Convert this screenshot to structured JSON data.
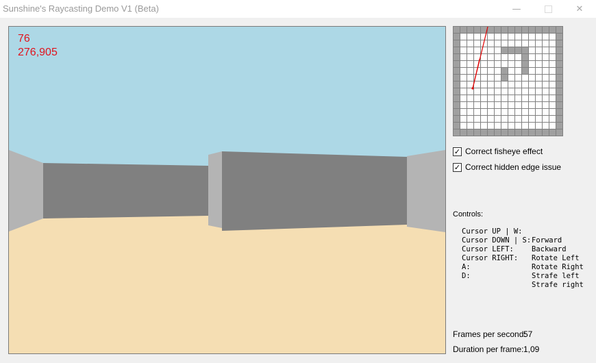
{
  "window": {
    "title": "Sunshine's Raycasting Demo V1 (Beta)",
    "minimize_glyph": "—",
    "close_glyph": "✕"
  },
  "hud": {
    "line1": "76",
    "line2": "276,905",
    "color": "#e0141e"
  },
  "scene": {
    "sky_color": "#add8e6",
    "floor_color": "#f5deb3",
    "wall_dark_color": "#808080",
    "wall_light_color": "#b4b4b4"
  },
  "minimap": {
    "grid": [
      "################",
      "#..............#",
      "#..............#",
      "#......####....#",
      "#.........#....#",
      "#.........#....#",
      "#......#..#....#",
      "#......#.......#",
      "#..............#",
      "#..............#",
      "#..............#",
      "#..............#",
      "#..............#",
      "#..............#",
      "#..............#",
      "################"
    ],
    "ray_color": "#e00000"
  },
  "options": {
    "fisheye": {
      "label": "Correct fisheye effect",
      "checked": true
    },
    "hidden_edge": {
      "label": "Correct hidden edge issue",
      "checked": true
    }
  },
  "controls": {
    "heading": "Controls:",
    "rows": [
      {
        "key": "Cursor UP | W:",
        "action": "Forward"
      },
      {
        "key": "Cursor DOWN | S:",
        "action": "Backward"
      },
      {
        "key": "Cursor LEFT:",
        "action": "Rotate Left"
      },
      {
        "key": "Cursor RIGHT:",
        "action": "Rotate Right"
      },
      {
        "key": "A:",
        "action": "Strafe left"
      },
      {
        "key": "D:",
        "action": "Strafe right"
      }
    ]
  },
  "stats": {
    "fps_label": "Frames per second:",
    "fps_value": "57",
    "duration_label": "Duration per frame:",
    "duration_value": "1,09"
  }
}
